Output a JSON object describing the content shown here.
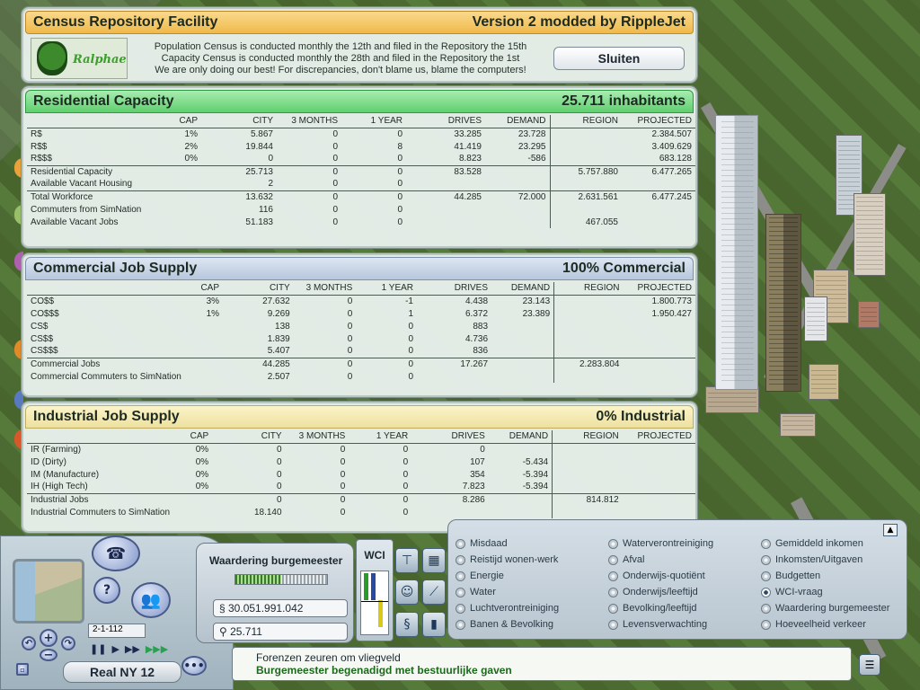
{
  "window": {
    "title": "Census Repository Facility",
    "version": "Version 2 modded by RippleJet",
    "logo_text": "Ralphael",
    "notes": [
      "Population Census is conducted monthly the 12th and filed in the Repository the 15th",
      "Capacity Census is conducted monthly the 28th and filed in the Repository the 1st",
      "We are only doing our best! For discrepancies, don't blame us, blame the computers!"
    ],
    "close_label": "Sluiten"
  },
  "columns": [
    "CAP",
    "CITY",
    "3 MONTHS",
    "1 YEAR",
    "DRIVES",
    "DEMAND",
    "REGION",
    "PROJECTED"
  ],
  "residential": {
    "title": "Residential Capacity",
    "summary": "25.711 inhabitants",
    "groups": [
      [
        {
          "label": "R$",
          "cap": "1%",
          "city": "5.867",
          "m3": "0",
          "y1": "0",
          "drives": "33.285",
          "demand": "23.728",
          "region": "",
          "projected": "2.384.507"
        },
        {
          "label": "R$$",
          "cap": "2%",
          "city": "19.844",
          "m3": "0",
          "y1": "8",
          "drives": "41.419",
          "demand": "23.295",
          "region": "",
          "projected": "3.409.629"
        },
        {
          "label": "R$$$",
          "cap": "0%",
          "city": "0",
          "m3": "0",
          "y1": "0",
          "drives": "8.823",
          "demand": "-586",
          "region": "",
          "projected": "683.128"
        }
      ],
      [
        {
          "label": "Residential Capacity",
          "cap": "",
          "city": "25.713",
          "m3": "0",
          "y1": "0",
          "drives": "83.528",
          "demand": "",
          "region": "5.757.880",
          "projected": "6.477.265"
        },
        {
          "label": "Available Vacant Housing",
          "cap": "",
          "city": "2",
          "m3": "0",
          "y1": "0",
          "drives": "",
          "demand": "",
          "region": "",
          "projected": ""
        }
      ],
      [
        {
          "label": "Total Workforce",
          "cap": "",
          "city": "13.632",
          "m3": "0",
          "y1": "0",
          "drives": "44.285",
          "demand": "72.000",
          "region": "2.631.561",
          "projected": "6.477.245"
        },
        {
          "label": "Commuters from SimNation",
          "cap": "",
          "city": "116",
          "m3": "0",
          "y1": "0",
          "drives": "",
          "demand": "",
          "region": "",
          "projected": ""
        },
        {
          "label": "Available Vacant Jobs",
          "cap": "",
          "city": "51.183",
          "m3": "0",
          "y1": "0",
          "drives": "",
          "demand": "",
          "region": "467.055",
          "projected": ""
        }
      ]
    ]
  },
  "commercial": {
    "title": "Commercial Job Supply",
    "summary": "100% Commercial",
    "groups": [
      [
        {
          "label": "CO$$",
          "cap": "3%",
          "city": "27.632",
          "m3": "0",
          "y1": "-1",
          "drives": "4.438",
          "demand": "23.143",
          "region": "",
          "projected": "1.800.773"
        },
        {
          "label": "CO$$$",
          "cap": "1%",
          "city": "9.269",
          "m3": "0",
          "y1": "1",
          "drives": "6.372",
          "demand": "23.389",
          "region": "",
          "projected": "1.950.427"
        },
        {
          "label": "CS$",
          "cap": "",
          "city": "138",
          "m3": "0",
          "y1": "0",
          "drives": "883",
          "demand": "",
          "region": "",
          "projected": ""
        },
        {
          "label": "CS$$",
          "cap": "",
          "city": "1.839",
          "m3": "0",
          "y1": "0",
          "drives": "4.736",
          "demand": "",
          "region": "",
          "projected": ""
        },
        {
          "label": "CS$$$",
          "cap": "",
          "city": "5.407",
          "m3": "0",
          "y1": "0",
          "drives": "836",
          "demand": "",
          "region": "",
          "projected": ""
        }
      ],
      [
        {
          "label": "Commercial Jobs",
          "cap": "",
          "city": "44.285",
          "m3": "0",
          "y1": "0",
          "drives": "17.267",
          "demand": "",
          "region": "2.283.804",
          "projected": ""
        },
        {
          "label": "Commercial Commuters to SimNation",
          "cap": "",
          "city": "2.507",
          "m3": "0",
          "y1": "0",
          "drives": "",
          "demand": "",
          "region": "",
          "projected": ""
        }
      ]
    ]
  },
  "industrial": {
    "title": "Industrial Job Supply",
    "summary": "0% Industrial",
    "groups": [
      [
        {
          "label": "IR (Farming)",
          "cap": "0%",
          "city": "0",
          "m3": "0",
          "y1": "0",
          "drives": "0",
          "demand": "",
          "region": "",
          "projected": ""
        },
        {
          "label": "ID (Dirty)",
          "cap": "0%",
          "city": "0",
          "m3": "0",
          "y1": "0",
          "drives": "107",
          "demand": "-5.434",
          "region": "",
          "projected": ""
        },
        {
          "label": "IM (Manufacture)",
          "cap": "0%",
          "city": "0",
          "m3": "0",
          "y1": "0",
          "drives": "354",
          "demand": "-5.394",
          "region": "",
          "projected": ""
        },
        {
          "label": "IH (High Tech)",
          "cap": "0%",
          "city": "0",
          "m3": "0",
          "y1": "0",
          "drives": "7.823",
          "demand": "-5.394",
          "region": "",
          "projected": ""
        }
      ],
      [
        {
          "label": "Industrial Jobs",
          "cap": "",
          "city": "0",
          "m3": "0",
          "y1": "0",
          "drives": "8.286",
          "demand": "",
          "region": "814.812",
          "projected": ""
        },
        {
          "label": "Industrial Commuters to SimNation",
          "cap": "",
          "city": "18.140",
          "m3": "0",
          "y1": "0",
          "drives": "",
          "demand": "",
          "region": "",
          "projected": ""
        }
      ]
    ]
  },
  "hud": {
    "date": "2-1-112",
    "city_name": "Real NY 12",
    "mayor_rating_title": "Waardering burgemeester",
    "mayor_rating_level": 0.5,
    "funds": "§ 30.051.991.042",
    "population": "25.711",
    "wci_title": "WCI",
    "overlays": [
      {
        "label": "Misdaad",
        "selected": false
      },
      {
        "label": "Waterverontreiniging",
        "selected": false
      },
      {
        "label": "Gemiddeld inkomen",
        "selected": false
      },
      {
        "label": "Reistijd wonen-werk",
        "selected": false
      },
      {
        "label": "Afval",
        "selected": false
      },
      {
        "label": "Inkomsten/Uitgaven",
        "selected": false
      },
      {
        "label": "Energie",
        "selected": false
      },
      {
        "label": "Onderwijs-quotiënt",
        "selected": false
      },
      {
        "label": "Budgetten",
        "selected": false
      },
      {
        "label": "Water",
        "selected": false
      },
      {
        "label": "Onderwijs/leeftijd",
        "selected": false
      },
      {
        "label": "WCI-vraag",
        "selected": true
      },
      {
        "label": "Luchtverontreiniging",
        "selected": false
      },
      {
        "label": "Bevolking/leeftijd",
        "selected": false
      },
      {
        "label": "Waardering burgemeester",
        "selected": false
      },
      {
        "label": "Banen & Bevolking",
        "selected": false
      },
      {
        "label": "Levensverwachting",
        "selected": false
      },
      {
        "label": "Hoeveelheid verkeer",
        "selected": false
      }
    ],
    "news": [
      "Forenzen zeuren om vliegveld",
      "Burgemeester begenadigd met bestuurlijke gaven"
    ]
  }
}
